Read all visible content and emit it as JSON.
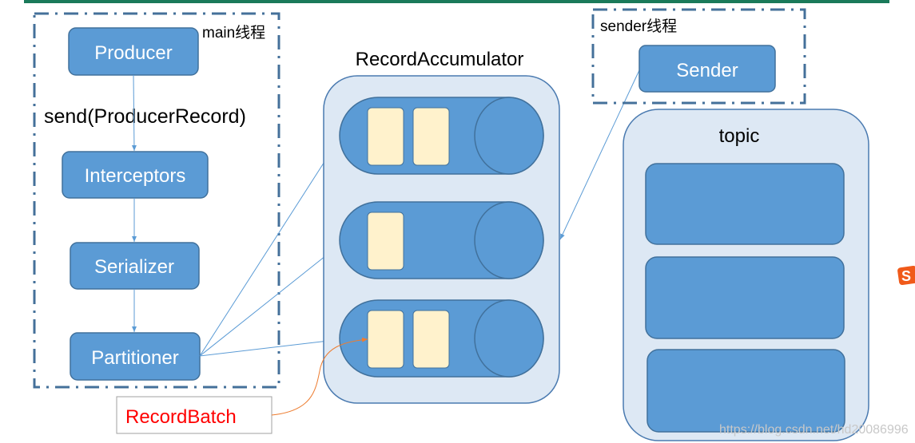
{
  "main_thread": {
    "label": "main线程",
    "producer": "Producer",
    "send_call": "send(ProducerRecord)",
    "interceptors": "Interceptors",
    "serializer": "Serializer",
    "partitioner": "Partitioner"
  },
  "accumulator": {
    "title": "RecordAccumulator",
    "queues": [
      {
        "batches": 2
      },
      {
        "batches": 1
      },
      {
        "batches": 2
      }
    ]
  },
  "sender_thread": {
    "label": "sender线程",
    "sender": "Sender"
  },
  "topic": {
    "title": "topic",
    "partitions": 3
  },
  "record_batch": {
    "label": "RecordBatch"
  },
  "watermark": "https://blog.csdn.net/hd20086996",
  "colors": {
    "box_fill": "#5b9bd5",
    "box_stroke": "#41719c",
    "container_fill": "#dde8f4",
    "batch_fill": "#fff2cc",
    "dashed_border": "#44709a",
    "record_batch_text": "#ff0000",
    "curve": "#ed7d31",
    "top_bar": "#1a7a5a"
  }
}
